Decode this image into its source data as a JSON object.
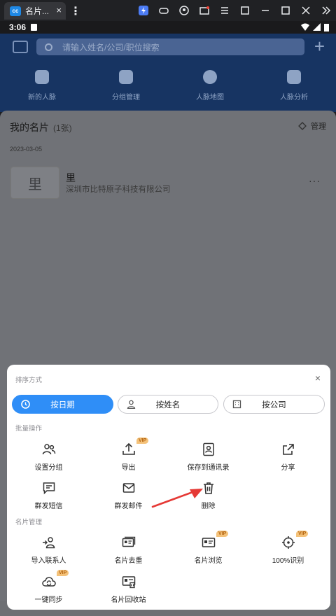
{
  "window": {
    "tab_title": "名片...",
    "tab_close": "×",
    "app_logo": "cc"
  },
  "status": {
    "time": "3:06"
  },
  "header": {
    "search_placeholder": "请输入姓名/公司/职位搜索",
    "add": "+"
  },
  "quick_actions": [
    {
      "label": "新的人脉",
      "icon": "new-contact-icon"
    },
    {
      "label": "分组管理",
      "icon": "folder-plus-icon"
    },
    {
      "label": "人脉地图",
      "icon": "map-pin-icon"
    },
    {
      "label": "人脉分析",
      "icon": "bar-chart-icon"
    }
  ],
  "cards": {
    "title": "我的名片",
    "count": "(1张)",
    "manage": "管理",
    "date": "2023-03-05",
    "item": {
      "thumb": "里",
      "name": "里",
      "company": "深圳市比特原子科技有限公司",
      "more": "···"
    }
  },
  "sheet": {
    "sort_title": "排序方式",
    "close": "×",
    "sort_options": [
      {
        "label": "按日期",
        "active": true
      },
      {
        "label": "按姓名",
        "active": false
      },
      {
        "label": "按公司",
        "active": false
      }
    ],
    "batch_title": "批量操作",
    "batch_items": [
      {
        "label": "设置分组",
        "icon": "users-group-icon",
        "vip": false
      },
      {
        "label": "导出",
        "icon": "upload-icon",
        "vip": true
      },
      {
        "label": "保存到通讯录",
        "icon": "address-book-icon",
        "vip": false
      },
      {
        "label": "分享",
        "icon": "share-icon",
        "vip": false
      },
      {
        "label": "群发短信",
        "icon": "sms-icon",
        "vip": false
      },
      {
        "label": "群发邮件",
        "icon": "mail-icon",
        "vip": false
      },
      {
        "label": "删除",
        "icon": "trash-icon",
        "vip": false
      }
    ],
    "manage_title": "名片管理",
    "manage_items": [
      {
        "label": "导入联系人",
        "icon": "import-contact-icon",
        "vip": false
      },
      {
        "label": "名片去重",
        "icon": "dedupe-card-icon",
        "vip": false
      },
      {
        "label": "名片浏览",
        "icon": "card-browse-icon",
        "vip": true
      },
      {
        "label": "100%识别",
        "icon": "target-icon",
        "vip": true
      },
      {
        "label": "一键同步",
        "icon": "cloud-sync-icon",
        "vip": true
      },
      {
        "label": "名片回收站",
        "icon": "card-recycle-icon",
        "vip": false
      }
    ],
    "vip_label": "VIP"
  },
  "colors": {
    "accent": "#2f8ef7",
    "annotation_arrow": "#e53935",
    "vip_bg": "#f4c27a"
  }
}
